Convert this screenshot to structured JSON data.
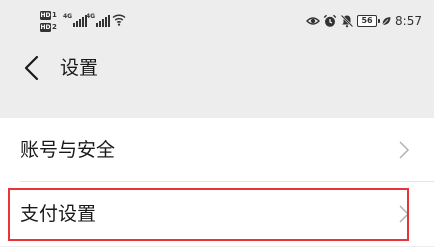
{
  "status_bar": {
    "sim1_badge": "HD",
    "sim1_num": "1",
    "sim2_badge": "HD",
    "sim2_num": "2",
    "signal1_gen": "4G",
    "signal2_gen": "4G",
    "battery": "56",
    "time": "8:57",
    "icons": [
      "eye-icon",
      "alarm-icon",
      "mute-icon",
      "battery-icon",
      "leaf-icon"
    ]
  },
  "header": {
    "back_icon": "chevron-left-icon",
    "title": "设置"
  },
  "settings": {
    "items": [
      {
        "label": "账号与安全",
        "icon": "chevron-right-icon"
      },
      {
        "label": "支付设置",
        "icon": "chevron-right-icon"
      }
    ]
  },
  "colors": {
    "background": "#ededed",
    "card": "#ffffff",
    "text": "#191919",
    "chevron": "#b2b2b2",
    "highlight": "#e8333a"
  }
}
